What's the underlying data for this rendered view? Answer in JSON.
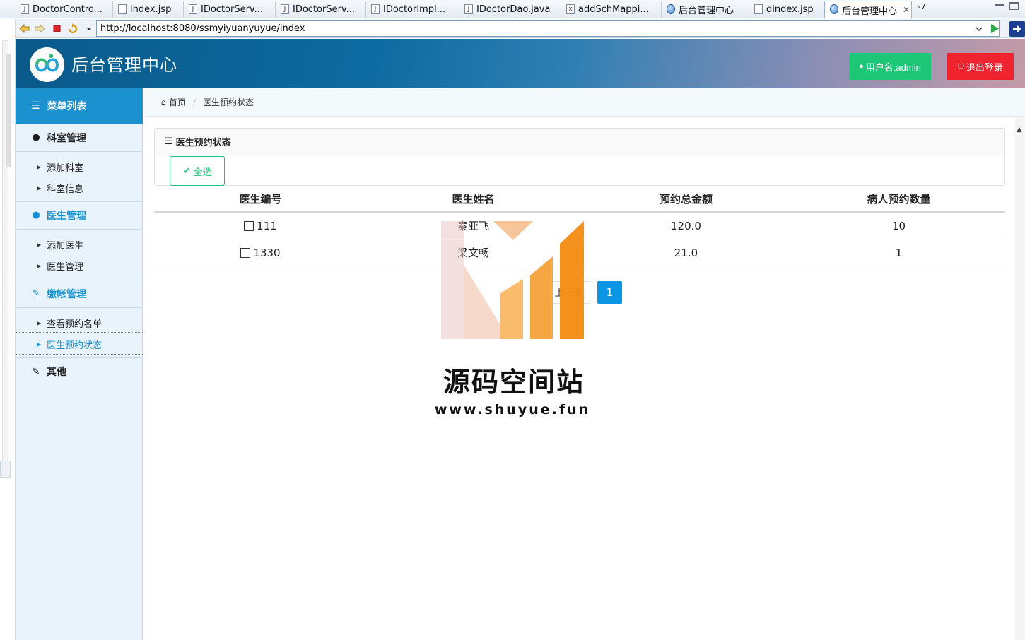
{
  "editor_tabs": [
    {
      "label": "DoctorContro...",
      "icon": "java-file-icon"
    },
    {
      "label": "index.jsp",
      "icon": "jsp-file-icon"
    },
    {
      "label": "IDoctorServ...",
      "icon": "java-file-icon"
    },
    {
      "label": "IDoctorServ...",
      "icon": "java-file-icon"
    },
    {
      "label": "IDoctorImpl...",
      "icon": "java-file-icon"
    },
    {
      "label": "IDoctorDao.java",
      "icon": "java-file-icon"
    },
    {
      "label": "addSchMappi...",
      "icon": "xml-file-icon"
    },
    {
      "label": "后台管理中心",
      "icon": "globe-icon"
    },
    {
      "label": "dindex.jsp",
      "icon": "jsp-file-icon"
    },
    {
      "label": "后台管理中心",
      "icon": "globe-icon",
      "active": true
    }
  ],
  "tab_overflow": "»7",
  "browser": {
    "url": "http://localhost:8080/ssmyiyuanyuyue/index"
  },
  "header": {
    "title": "后台管理中心",
    "user_label": "用户名:admin",
    "logout_label": "退出登录",
    "colors": {
      "user_button": "#1ec678",
      "logout_button": "#f0242e"
    }
  },
  "sidebar": {
    "menu_title": "菜单列表",
    "groups": [
      {
        "label": "科室管理",
        "icon": "user-icon",
        "items": [
          "添加科室",
          "科室信息"
        ]
      },
      {
        "label": "医生管理",
        "icon": "user-icon",
        "items": [
          "添加医生",
          "医生管理"
        ]
      },
      {
        "label": "缴帐管理",
        "icon": "edit-icon",
        "items": [
          "查看预约名单",
          "医生预约状态"
        ]
      },
      {
        "label": "其他",
        "icon": "edit-icon",
        "items": []
      }
    ],
    "active_item": "医生预约状态",
    "accent": "#1691d3"
  },
  "breadcrumb": {
    "home": "首页",
    "current": "医生预约状态"
  },
  "panel": {
    "title": "医生预约状态",
    "select_all_label": "全选"
  },
  "table": {
    "columns": [
      "医生编号",
      "医生姓名",
      "预约总金额",
      "病人预约数量"
    ],
    "rows": [
      {
        "id": "111",
        "name": "秦亚飞",
        "amount": "120.0",
        "count": "10"
      },
      {
        "id": "1330",
        "name": "梁文畅",
        "amount": "21.0",
        "count": "1"
      }
    ]
  },
  "pagination": {
    "prev_label": "上一页",
    "pages": [
      "1"
    ],
    "current": "1"
  },
  "watermark": {
    "text": "源码空间站",
    "url": "www.shuyue.fun"
  }
}
